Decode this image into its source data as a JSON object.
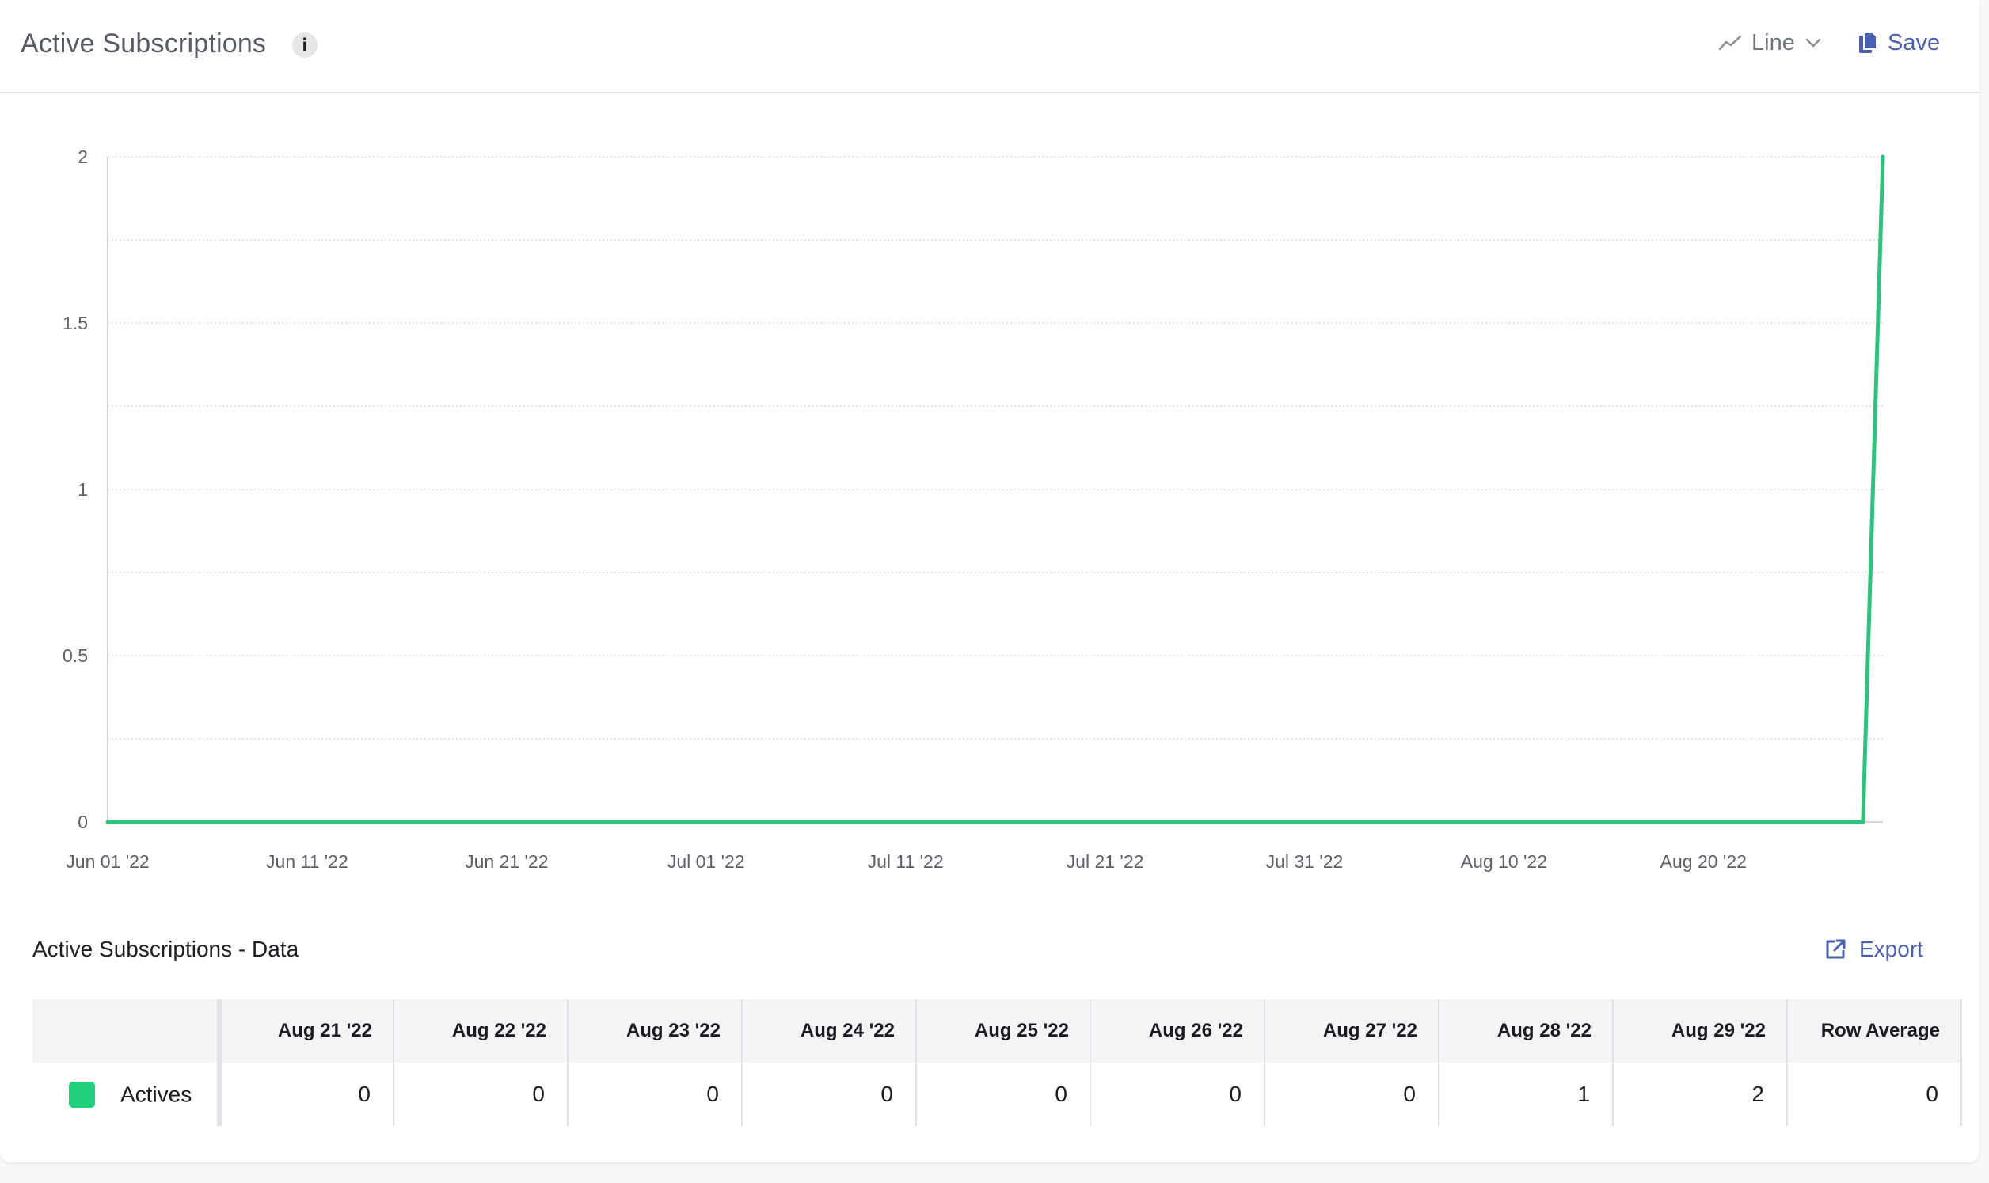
{
  "header": {
    "title": "Active Subscriptions",
    "info_glyph": "i",
    "chart_type_label": "Line",
    "save_label": "Save"
  },
  "colors": {
    "series": "#2ec27e",
    "accent": "#4a5fb0"
  },
  "chart_data": {
    "type": "line",
    "title": "",
    "xlabel": "",
    "ylabel": "",
    "ylim": [
      0,
      2
    ],
    "yticks": [
      0,
      0.5,
      1,
      1.5,
      2
    ],
    "ytick_labels": [
      "0",
      "0.5",
      "1",
      "1.5",
      "2"
    ],
    "x_ticks": [
      {
        "date": "2022-06-01",
        "label": "Jun 01 '22"
      },
      {
        "date": "2022-06-11",
        "label": "Jun 11 '22"
      },
      {
        "date": "2022-06-21",
        "label": "Jun 21 '22"
      },
      {
        "date": "2022-07-01",
        "label": "Jul 01 '22"
      },
      {
        "date": "2022-07-11",
        "label": "Jul 11 '22"
      },
      {
        "date": "2022-07-21",
        "label": "Jul 21 '22"
      },
      {
        "date": "2022-07-31",
        "label": "Jul 31 '22"
      },
      {
        "date": "2022-08-10",
        "label": "Aug 10 '22"
      },
      {
        "date": "2022-08-20",
        "label": "Aug 20 '22"
      }
    ],
    "xlim": [
      "2022-06-01",
      "2022-08-29"
    ],
    "grid": true,
    "legend": "none",
    "series": [
      {
        "name": "Actives",
        "color": "#2ec27e",
        "points": [
          {
            "x": "2022-06-01",
            "y": 0
          },
          {
            "x": "2022-08-28",
            "y": 0
          },
          {
            "x": "2022-08-29",
            "y": 2
          }
        ]
      }
    ]
  },
  "data_section": {
    "title": "Active Subscriptions - Data",
    "export_label": "Export",
    "columns": [
      "Aug 21 '22",
      "Aug 22 '22",
      "Aug 23 '22",
      "Aug 24 '22",
      "Aug 25 '22",
      "Aug 26 '22",
      "Aug 27 '22",
      "Aug 28 '22",
      "Aug 29 '22",
      "Row Average"
    ],
    "rows": [
      {
        "name": "Actives",
        "color": "#21d07a",
        "values": [
          "0",
          "0",
          "0",
          "0",
          "0",
          "0",
          "0",
          "1",
          "2",
          "0"
        ]
      }
    ]
  }
}
